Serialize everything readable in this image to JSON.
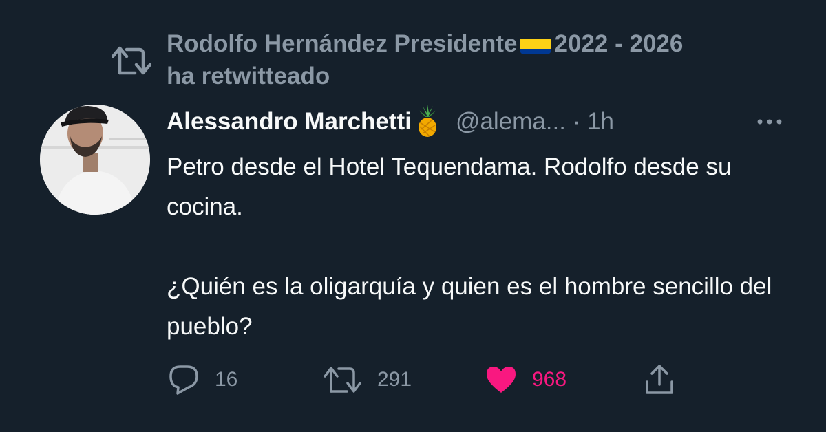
{
  "retweet_context": {
    "icon": "retweet-icon",
    "retweeter_name": "Rodolfo Hernández Presidente",
    "flag": "colombia-flag",
    "retweeter_years": "2022 - 2026",
    "action_text": "ha retwitteado"
  },
  "tweet": {
    "avatar": "user-avatar",
    "display_name": "Alessandro Marchetti",
    "name_emoji": "pineapple",
    "handle": "@alema...",
    "separator": "·",
    "time": "1h",
    "more_icon": "more-dots-icon",
    "body_paragraphs": [
      "Petro desde el Hotel Tequendama. Rodolfo desde su cocina.",
      "¿Quién es la oligarquía y quien es el hombre sencillo del pueblo?"
    ]
  },
  "actions": {
    "reply": {
      "icon": "reply-icon",
      "count": "16"
    },
    "retweet": {
      "icon": "retweet-icon",
      "count": "291"
    },
    "like": {
      "icon": "heart-icon",
      "count": "968",
      "liked": true
    },
    "share": {
      "icon": "share-icon"
    }
  },
  "colors": {
    "background": "#15202b",
    "text_primary": "#f7f9f9",
    "text_secondary": "#8b98a5",
    "like_pink": "#f91880"
  }
}
